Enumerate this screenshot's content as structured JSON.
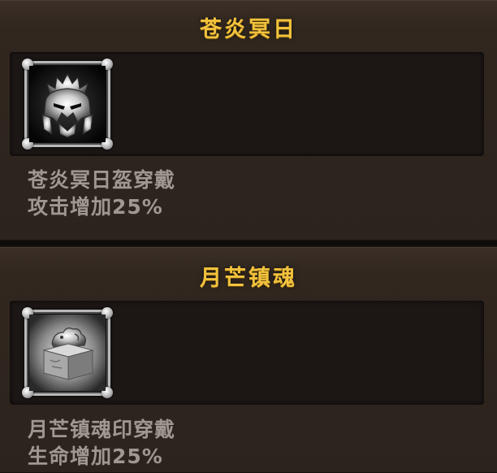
{
  "sets": [
    {
      "title": "苍炎冥日",
      "item_icon": "demon-helmet-icon",
      "effect_line1": "苍炎冥日盔穿戴",
      "effect_line2": "攻击增加25%"
    },
    {
      "title": "月芒镇魂",
      "item_icon": "beast-seal-icon",
      "effect_line1": "月芒镇魂印穿戴",
      "effect_line2": "生命增加25%"
    }
  ],
  "colors": {
    "title": "#f2c23c",
    "description": "#9f9792",
    "panel": "#2c231d",
    "item_box": "#1c1615",
    "frame": "#b9b9b9"
  }
}
